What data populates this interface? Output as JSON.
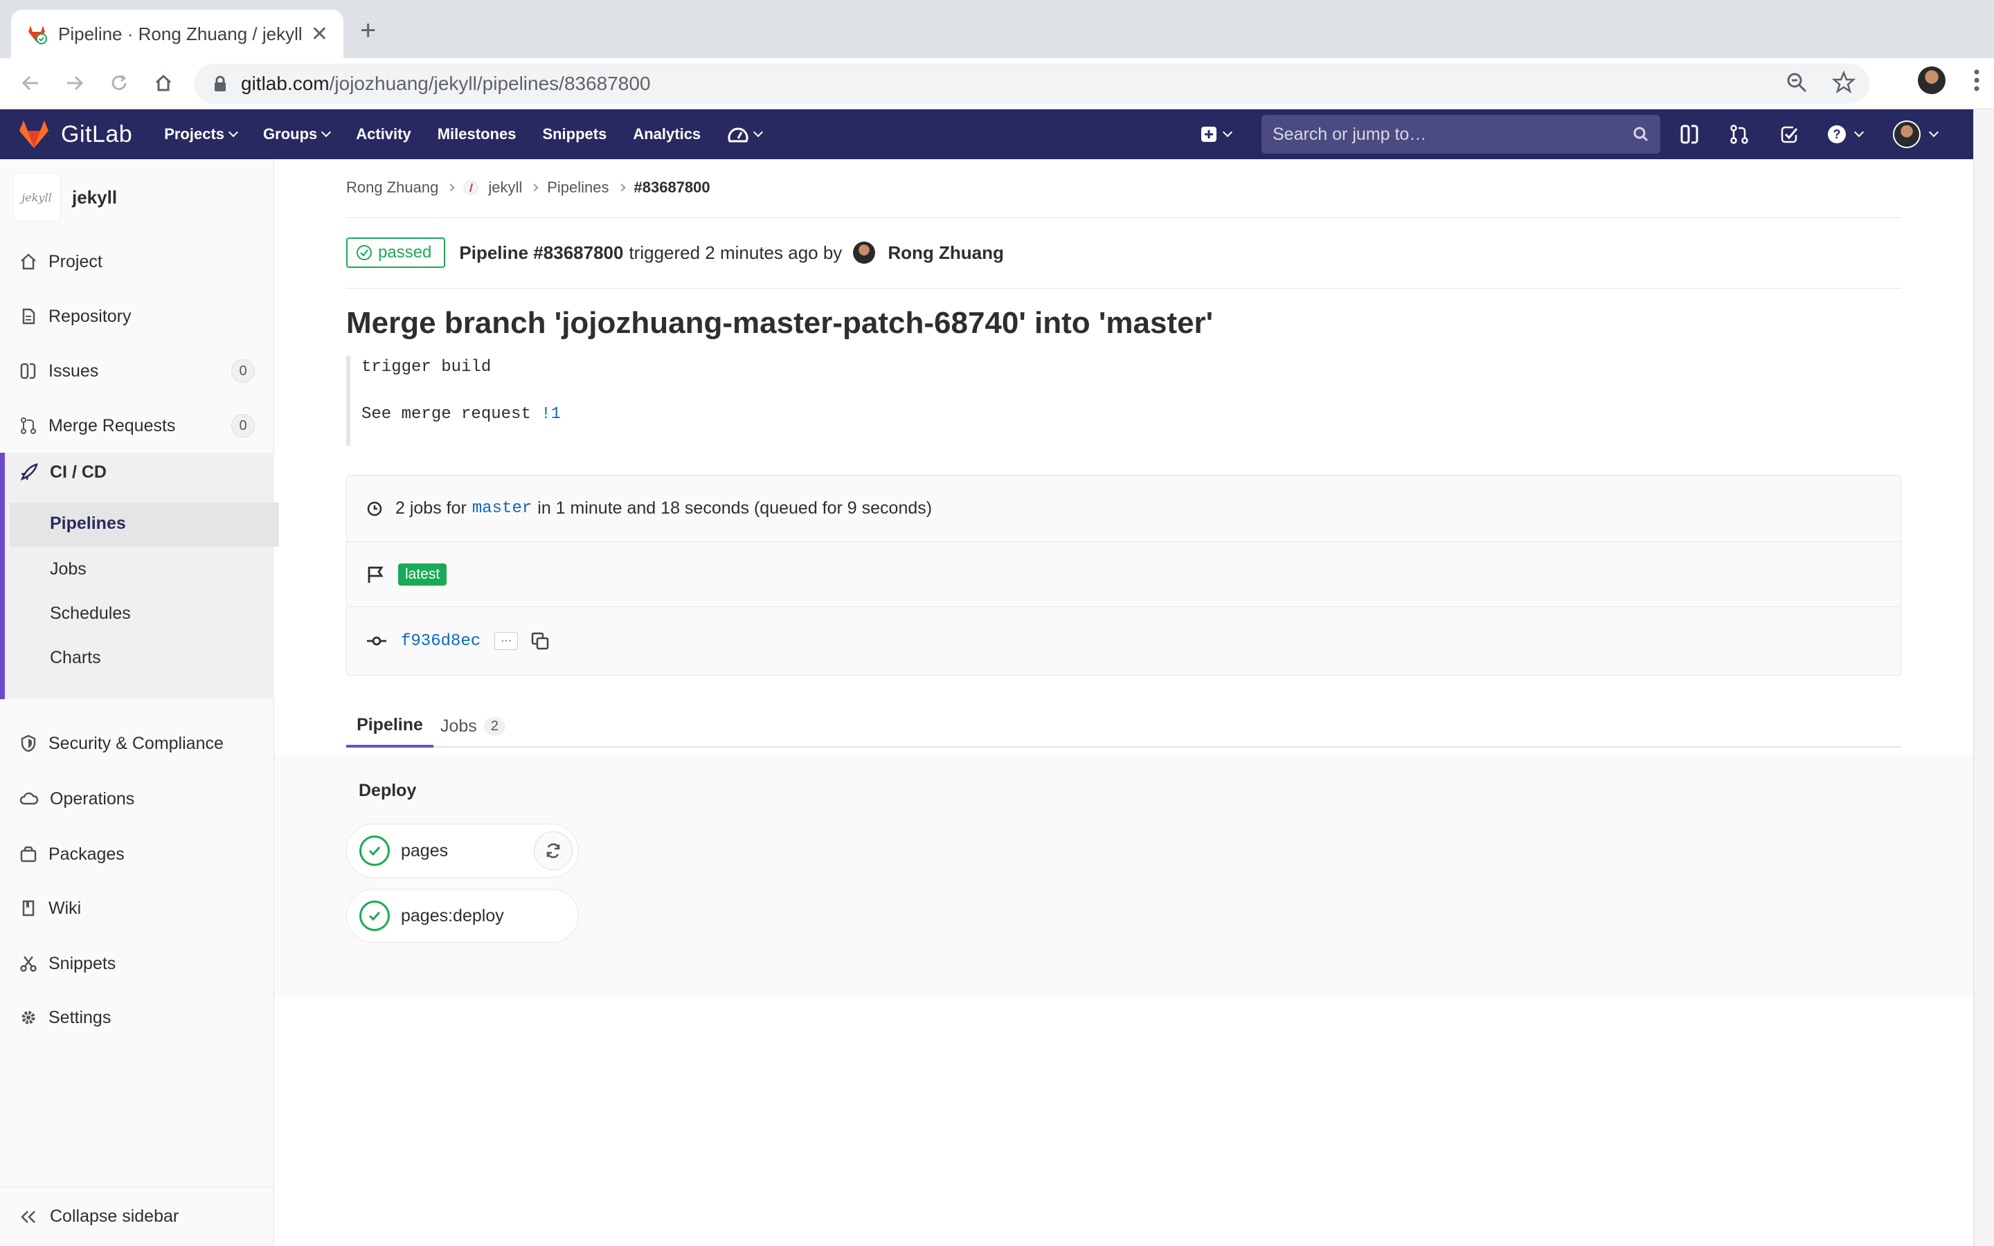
{
  "browser": {
    "tab_title": "Pipeline · Rong Zhuang / jekyll",
    "url_host": "gitlab.com",
    "url_path": "/jojozhuang/jekyll/pipelines/83687800"
  },
  "gitlab_nav": {
    "logo_text": "GitLab",
    "menu": [
      "Projects",
      "Groups",
      "Activity",
      "Milestones",
      "Snippets",
      "Analytics"
    ],
    "search_placeholder": "Search or jump to…"
  },
  "sidebar": {
    "project_name": "jekyll",
    "project_avatar_text": "jekyll",
    "items": [
      {
        "label": "Project",
        "icon": "home-icon"
      },
      {
        "label": "Repository",
        "icon": "doc-icon"
      },
      {
        "label": "Issues",
        "icon": "issues-icon",
        "count": "0"
      },
      {
        "label": "Merge Requests",
        "icon": "merge-request-icon",
        "count": "0"
      },
      {
        "label": "CI / CD",
        "icon": "rocket-icon"
      },
      {
        "label": "Security & Compliance",
        "icon": "shield-icon"
      },
      {
        "label": "Operations",
        "icon": "cloud-icon"
      },
      {
        "label": "Packages",
        "icon": "package-icon"
      },
      {
        "label": "Wiki",
        "icon": "book-icon"
      },
      {
        "label": "Snippets",
        "icon": "scissors-icon"
      },
      {
        "label": "Settings",
        "icon": "gear-icon"
      }
    ],
    "cicd_sub": [
      "Pipelines",
      "Jobs",
      "Schedules",
      "Charts"
    ],
    "collapse_label": "Collapse sidebar"
  },
  "breadcrumbs": [
    "Rong Zhuang",
    "jekyll",
    "Pipelines",
    "#83687800"
  ],
  "pipeline": {
    "status": "passed",
    "id_label": "Pipeline #83687800",
    "triggered_text": "triggered 2 minutes ago by",
    "user": "Rong Zhuang",
    "title": "Merge branch 'jojozhuang-master-patch-68740' into 'master'",
    "commit_line1": "trigger build",
    "commit_line2_prefix": "See merge request",
    "commit_line2_link": "!1",
    "jobs_prefix": "2 jobs for",
    "branch": "master",
    "jobs_suffix": "in 1 minute and 18 seconds (queued for 9 seconds)",
    "latest_badge": "latest",
    "sha": "f936d8ec",
    "ellipsis": "···"
  },
  "tabs": {
    "pipeline": "Pipeline",
    "jobs": "Jobs",
    "jobs_count": "2"
  },
  "graph": {
    "stage": "Deploy",
    "jobs": [
      "pages",
      "pages:deploy"
    ]
  },
  "colors": {
    "nav_bg": "#292961",
    "success": "#1aaa55",
    "accent": "#6e49cb",
    "link": "#1068bf"
  }
}
